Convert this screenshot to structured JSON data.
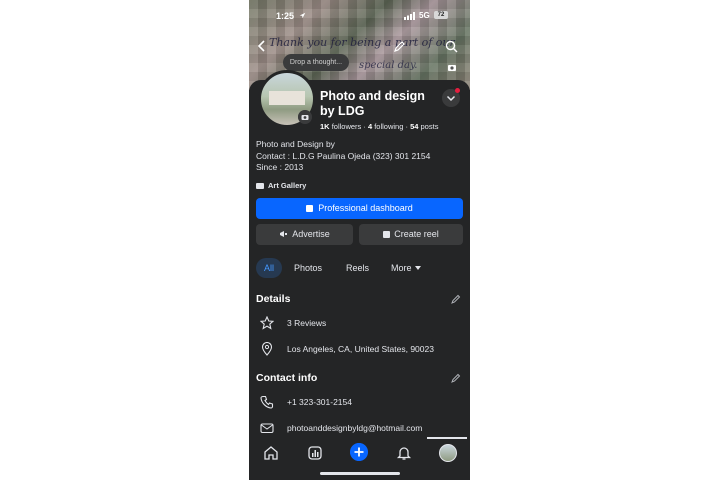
{
  "status_bar": {
    "time": "1:25",
    "network": "5G",
    "battery": "72"
  },
  "cover": {
    "thought_placeholder": "Drop a thought...",
    "script_line_1": "Thank you for being a part of our",
    "script_line_2": "special day."
  },
  "profile": {
    "name": "Photo and design by LDG",
    "followers": "1K",
    "followers_label": "followers",
    "following": "4",
    "following_label": "following",
    "posts": "54",
    "posts_label": "posts",
    "bio": [
      "Photo and Design by",
      "Contact : L.D.G Paulina Ojeda (323) 301 2154",
      "Since : 2013"
    ],
    "category": "Art Gallery"
  },
  "buttons": {
    "professional_dashboard": "Professional dashboard",
    "advertise": "Advertise",
    "create_reel": "Create reel"
  },
  "tabs": [
    {
      "label": "All",
      "active": true
    },
    {
      "label": "Photos",
      "active": false
    },
    {
      "label": "Reels",
      "active": false
    },
    {
      "label": "More",
      "active": false
    }
  ],
  "details": {
    "title": "Details",
    "reviews": "3 Reviews",
    "location": "Los Angeles, CA, United States, 90023"
  },
  "contact": {
    "title": "Contact info",
    "phone": "+1 323-301-2154",
    "email": "photoanddesignbyldg@hotmail.com"
  },
  "colors": {
    "accent": "#0866ff",
    "background": "#242526",
    "button_secondary": "#3a3b3c",
    "notification": "#e41e3f"
  },
  "icons": {
    "status": [
      "location-arrow-icon",
      "signal-icon"
    ],
    "cover": [
      "back-icon",
      "pencil-icon",
      "search-icon",
      "camera-icon"
    ],
    "nav": [
      "home-icon",
      "dashboard-icon",
      "add-icon",
      "bell-icon",
      "profile-avatar"
    ]
  }
}
